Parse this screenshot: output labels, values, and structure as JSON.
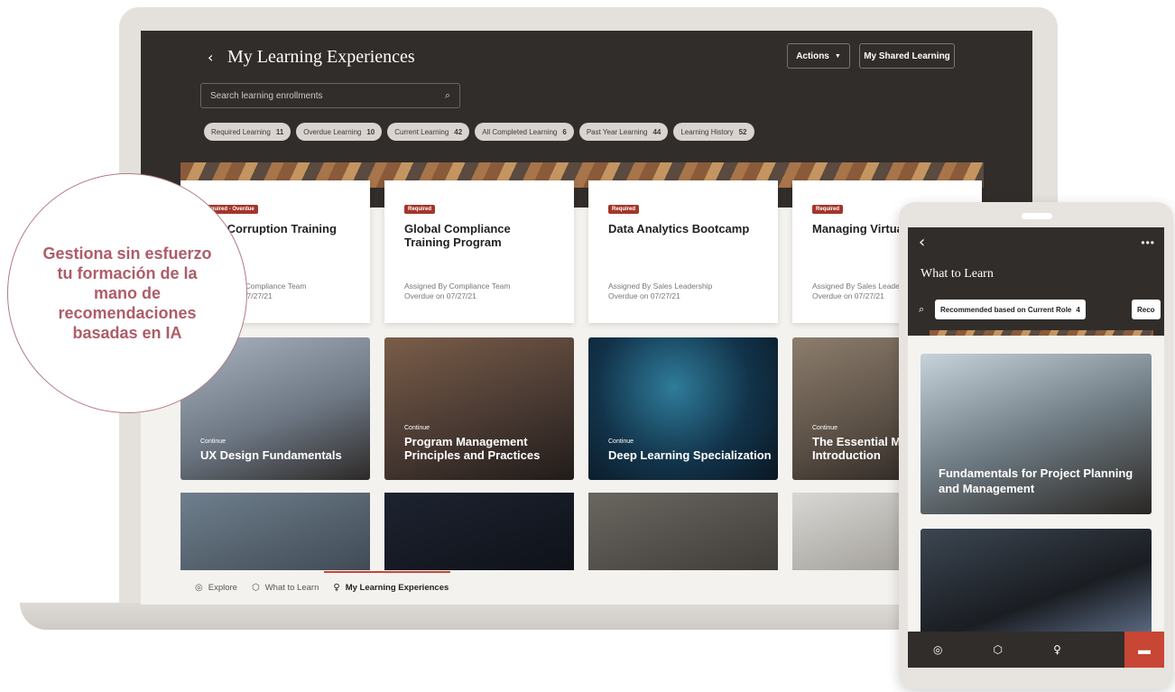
{
  "callout": {
    "text": "Gestiona sin esfuerzo tu formación de la mano de recomendaciones basadas en IA"
  },
  "laptop": {
    "back_icon": "chevron-left-icon",
    "title": "My Learning Experiences",
    "actions_label": "Actions",
    "shared_label": "My Shared Learning",
    "search_placeholder": "Search learning enrollments",
    "chips": [
      {
        "label": "Required Learning",
        "count": "11"
      },
      {
        "label": "Overdue Learning",
        "count": "10"
      },
      {
        "label": "Current Learning",
        "count": "42"
      },
      {
        "label": "All Completed Learning",
        "count": "6"
      },
      {
        "label": "Past Year Learning",
        "count": "44"
      },
      {
        "label": "Learning History",
        "count": "52"
      }
    ],
    "cards": [
      {
        "badge": "Required - Overdue",
        "title": "Anti-Corruption Training",
        "assigned": "Assigned By Compliance Team",
        "due": "Overdue on 07/27/21"
      },
      {
        "badge": "Required",
        "title": "Global Compliance Training Program",
        "assigned": "Assigned By Compliance Team",
        "due": "Overdue on 07/27/21"
      },
      {
        "badge": "Required",
        "title": "Data Analytics Bootcamp",
        "assigned": "Assigned By Sales Leadership",
        "due": "Overdue on 07/27/21"
      },
      {
        "badge": "Required",
        "title": "Managing Virtual Teams",
        "assigned": "Assigned By Sales Leadership",
        "due": "Overdue on 07/27/21"
      }
    ],
    "tiles": [
      {
        "status": "Continue",
        "title": "UX Design Fundamentals"
      },
      {
        "status": "Continue",
        "title": "Program Management Principles and Practices"
      },
      {
        "status": "Continue",
        "title": "Deep Learning Specialization"
      },
      {
        "status": "Continue",
        "title": "The Essential Manager: Introduction"
      }
    ],
    "nav": [
      {
        "label": "Explore",
        "icon": "eye-icon"
      },
      {
        "label": "What to Learn",
        "icon": "cube-icon"
      },
      {
        "label": "My Learning Experiences",
        "icon": "lightbulb-icon"
      }
    ]
  },
  "phone": {
    "back_icon": "chevron-left-icon",
    "more_label": "•••",
    "title": "What to Learn",
    "chip_label": "Recommended based on Current Role",
    "chip_count": "4",
    "chip2_label": "Reco",
    "card1_title": "Fundamentals for Project Planning and Management",
    "chat_icon": "chat-icon"
  }
}
